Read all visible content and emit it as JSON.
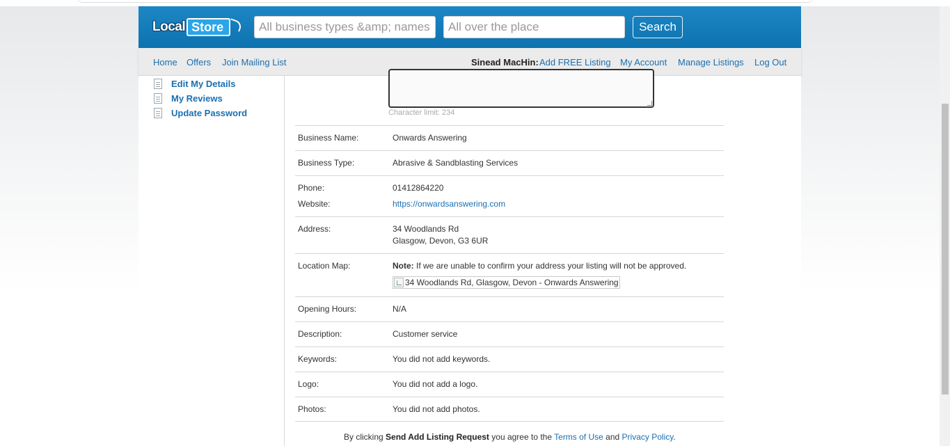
{
  "header": {
    "logo_local": "Local",
    "logo_store": "Store",
    "search_what_placeholder": "All business types &amp; names",
    "search_where_placeholder": "All over the place",
    "search_button": "Search"
  },
  "nav": {
    "left": [
      "Home",
      "Offers",
      "Join Mailing List"
    ],
    "user_name": "Sinead MacHin:",
    "right": [
      "Add FREE Listing",
      "My Account",
      "Manage Listings",
      "Log Out"
    ]
  },
  "sidebar": {
    "items": [
      {
        "label": "Edit My Details",
        "icon": "document-icon"
      },
      {
        "label": "My Reviews",
        "icon": "document-icon"
      },
      {
        "label": "Update Password",
        "icon": "document-icon"
      }
    ]
  },
  "form": {
    "char_limit": "Character limit: 234",
    "business_name_label": "Business Name:",
    "business_name": "Onwards Answering",
    "business_type_label": "Business Type:",
    "business_type": "Abrasive & Sandblasting Services",
    "phone_label": "Phone:",
    "phone": "01412864220",
    "website_label": "Website:",
    "website": "https://onwardsanswering.com",
    "address_label": "Address:",
    "address_line1": "34 Woodlands Rd",
    "address_line2": "Glasgow, Devon, G3 6UR",
    "map_label": "Location Map:",
    "map_note_bold": "Note:",
    "map_note": "If we are unable to confirm your address your listing will not be approved.",
    "map_alt": "34 Woodlands Rd, Glasgow, Devon - Onwards Answering",
    "hours_label": "Opening Hours:",
    "hours": "N/A",
    "description_label": "Description:",
    "description": "Customer service",
    "keywords_label": "Keywords:",
    "keywords": "You did not add keywords.",
    "logo_label": "Logo:",
    "logo": "You did not add a logo.",
    "photos_label": "Photos:",
    "photos": "You did not add photos."
  },
  "agreement": {
    "prefix": "By clicking",
    "button_name": "Send Add Listing Request",
    "middle": "you agree to the",
    "terms": "Terms of Use",
    "and": "and",
    "privacy": "Privacy Policy",
    "end": "."
  }
}
